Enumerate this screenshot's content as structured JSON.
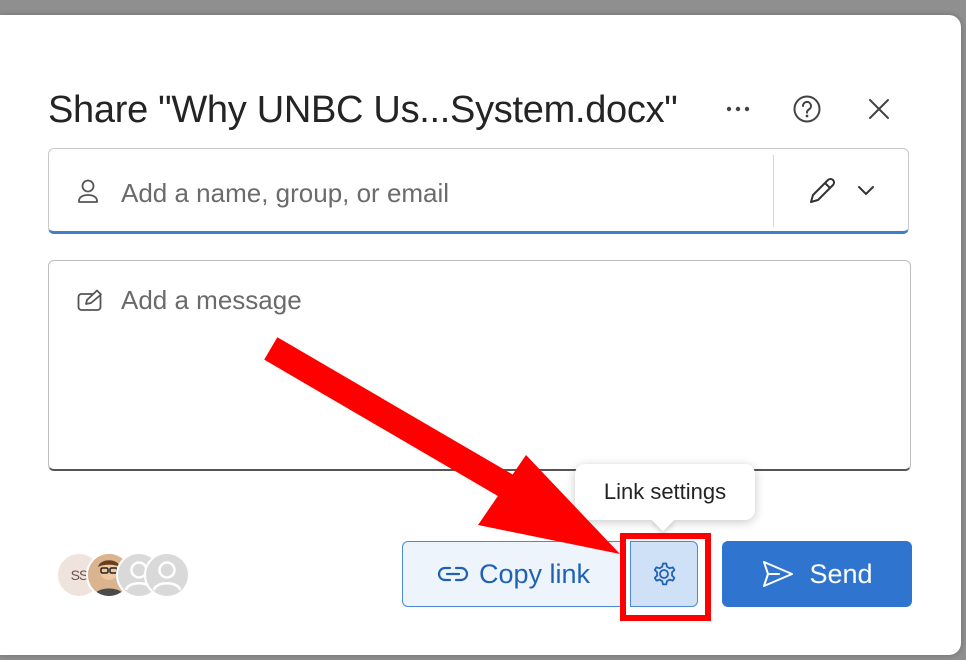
{
  "dialog": {
    "title": "Share \"Why UNBC Us...System.docx\"",
    "more_icon": "more-horizontal-icon",
    "help_icon": "help-circle-icon",
    "close_icon": "close-icon"
  },
  "recipient_field": {
    "placeholder": "Add a name, group, or email",
    "person_icon": "person-icon",
    "permission_icon": "pencil-edit-icon",
    "dropdown_icon": "chevron-down-icon"
  },
  "message_field": {
    "placeholder": "Add a message",
    "icon": "compose-icon"
  },
  "avatars": {
    "initials": "SS"
  },
  "actions": {
    "copy_link_label": "Copy link",
    "copy_link_icon": "link-icon",
    "link_settings_icon": "gear-icon",
    "send_label": "Send",
    "send_icon": "send-icon"
  },
  "tooltip": {
    "text": "Link settings"
  },
  "colors": {
    "accent": "#2f75cf",
    "annotation": "#ff0000"
  }
}
